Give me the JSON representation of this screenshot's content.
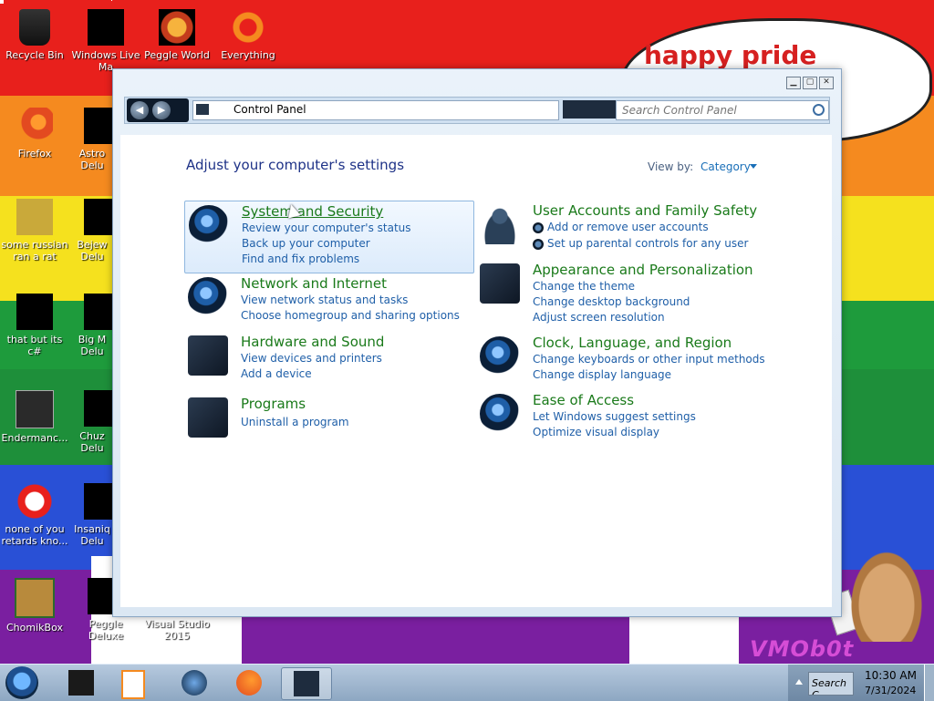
{
  "desktop": {
    "speech_bubble": "happy pride month",
    "watermark": "VMOb0t",
    "icons": [
      {
        "label": "Recycle Bin",
        "icon": "recycle-bin-icon"
      },
      {
        "label": "Windows Live Ma",
        "icon": "windows-live-icon"
      },
      {
        "label": "Peggle World",
        "icon": "peggle-icon"
      },
      {
        "label": "Everything",
        "icon": "everything-icon"
      },
      {
        "label": "Firefox",
        "icon": "firefox-icon"
      },
      {
        "label": "Astro Delu",
        "icon": "astro-icon"
      },
      {
        "label": "some russian ran a rat",
        "icon": "document-icon"
      },
      {
        "label": "Bejew Delu",
        "icon": "bejeweled-icon"
      },
      {
        "label": "that but its c#",
        "icon": "stack-icon"
      },
      {
        "label": "Big M Delu",
        "icon": "game-icon"
      },
      {
        "label": "Endermanc...",
        "icon": "terminal-icon"
      },
      {
        "label": "Chuz Delu",
        "icon": "game-icon"
      },
      {
        "label": "none of you retards kno...",
        "icon": "red-ring-icon"
      },
      {
        "label": "Insaniq Delu",
        "icon": "game-icon"
      },
      {
        "label": "ChomikBox",
        "icon": "chomikbox-icon"
      },
      {
        "label": "Peggle Deluxe",
        "icon": "peggle-deluxe-icon"
      },
      {
        "label": "Visual Studio 2015",
        "icon": "visual-studio-icon"
      }
    ]
  },
  "window": {
    "breadcrumb": "Control Panel",
    "search_placeholder": "Search Control Panel",
    "heading": "Adjust your computer's settings",
    "view_by_label": "View by:",
    "view_by_value": "Category",
    "categories_left": [
      {
        "title": "System and Security",
        "links": [
          "Review your computer's status",
          "Back up your computer",
          "Find and fix problems"
        ]
      },
      {
        "title": "Network and Internet",
        "links": [
          "View network status and tasks",
          "Choose homegroup and sharing options"
        ]
      },
      {
        "title": "Hardware and Sound",
        "links": [
          "View devices and printers",
          "Add a device"
        ]
      },
      {
        "title": "Programs",
        "links": [
          "Uninstall a program"
        ]
      }
    ],
    "categories_right": [
      {
        "title": "User Accounts and Family Safety",
        "links": [
          "Add or remove user accounts",
          "Set up parental controls for any user"
        ]
      },
      {
        "title": "Appearance and Personalization",
        "links": [
          "Change the theme",
          "Change desktop background",
          "Adjust screen resolution"
        ]
      },
      {
        "title": "Clock, Language, and Region",
        "links": [
          "Change keyboards or other input methods",
          "Change display language"
        ]
      },
      {
        "title": "Ease of Access",
        "links": [
          "Let Windows suggest settings",
          "Optimize visual display"
        ]
      }
    ]
  },
  "taskbar": {
    "tray_search": "Search C",
    "time": "10:30 AM",
    "date": "7/31/2024"
  }
}
